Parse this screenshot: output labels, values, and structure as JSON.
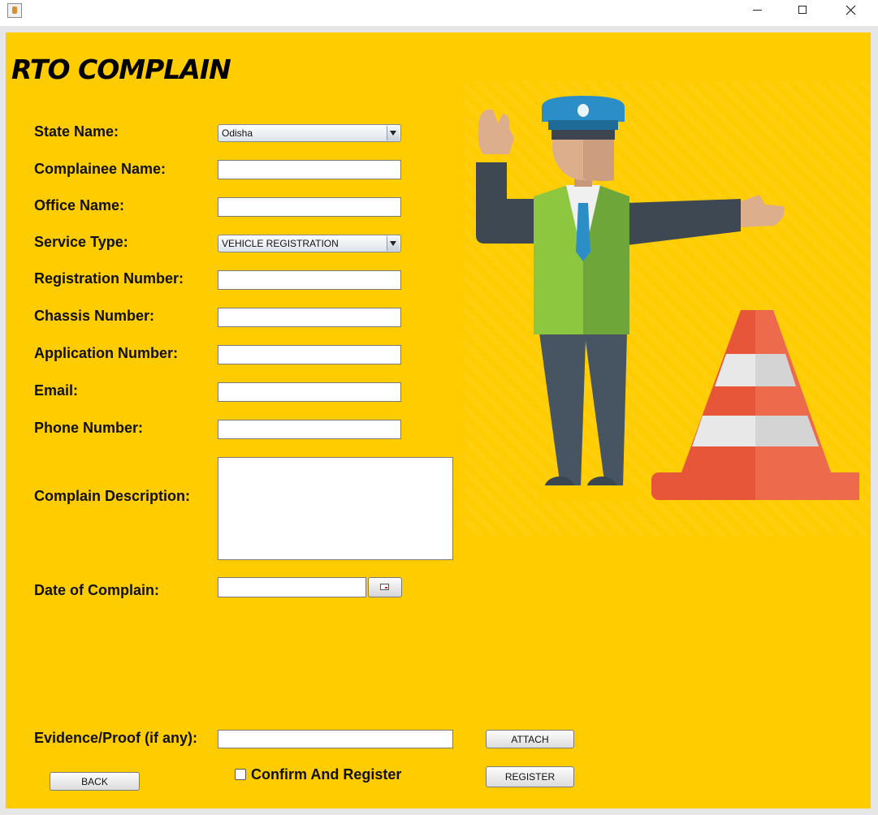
{
  "window": {
    "app_icon": "java-coffee-icon",
    "controls": [
      "minimize-icon",
      "maximize-icon",
      "close-icon"
    ]
  },
  "form": {
    "title": "RTO COMPLAIN",
    "labels": {
      "state": "State Name:",
      "complainee": "Complainee Name:",
      "office": "Office Name:",
      "service": "Service Type:",
      "registration": "Registration Number:",
      "chassis": "Chassis Number:",
      "application": "Application Number:",
      "email": "Email:",
      "phone": "Phone Number:",
      "description": "Complain Description:",
      "date": "Date of Complain:",
      "evidence": "Evidence/Proof (if any):"
    },
    "values": {
      "state": "Odisha",
      "service": "VEHICLE REGISTRATION",
      "complainee": "",
      "office": "",
      "registration": "",
      "chassis": "",
      "application": "",
      "email": "",
      "phone": "",
      "description": "",
      "date": "",
      "evidence": ""
    },
    "buttons": {
      "attach": "ATTACH",
      "back": "BACK",
      "register": "REGISTER"
    },
    "confirm_label": "Confirm And Register",
    "confirm_checked": false,
    "calendar_icon": "calendar-icon"
  },
  "illustration": {
    "subjects": [
      "traffic-police-officer",
      "traffic-cone"
    ]
  },
  "colors": {
    "panel_background": "#ffcc00",
    "vest": "#8dc63f",
    "cap": "#2b8ec6",
    "cone": "#e8563a"
  }
}
